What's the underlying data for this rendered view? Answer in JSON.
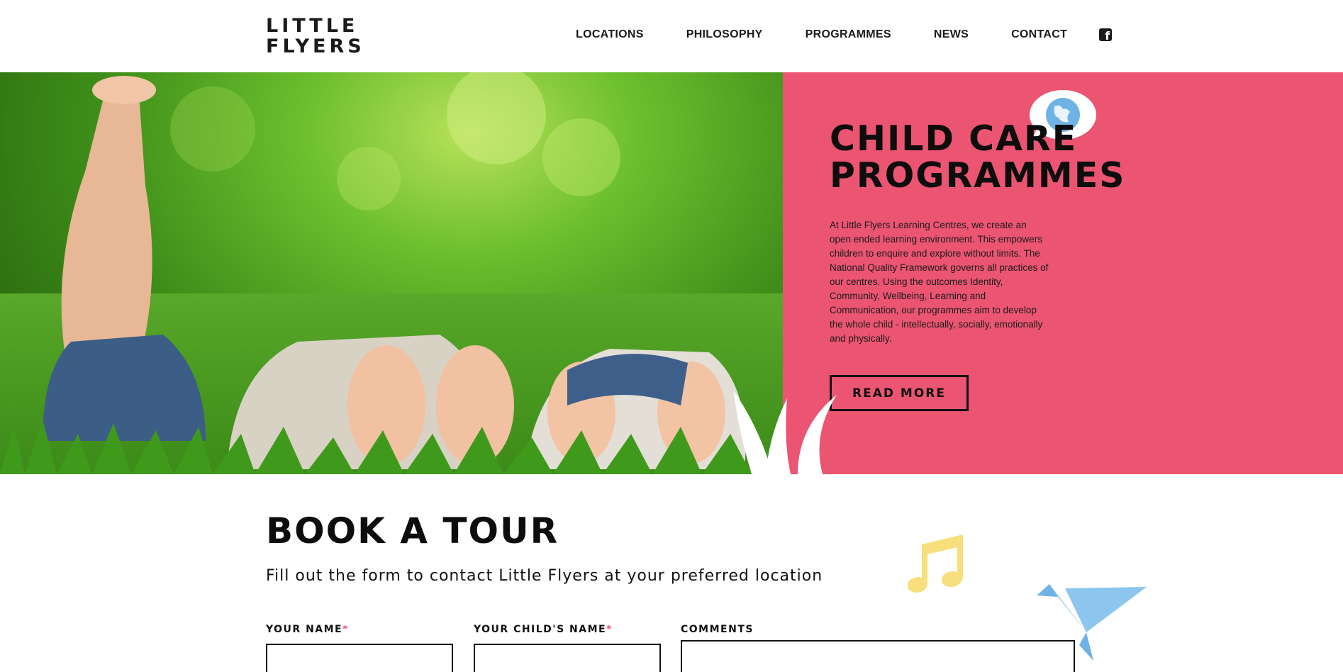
{
  "header": {
    "logo_line1": "LITTLE",
    "logo_line2": "FLYERS",
    "nav": [
      "LOCATIONS",
      "PHILOSOPHY",
      "PROGRAMMES",
      "NEWS",
      "CONTACT"
    ],
    "social_icon": "facebook-icon"
  },
  "hero": {
    "title_line1": "CHILD CARE",
    "title_line2": "PROGRAMMES",
    "body": "At Little Flyers Learning Centres, we create an open ended learning environment. This empowers children to enquire and explore without limits. The National Quality Framework governs all practices of our centres. Using the outcomes Identity, Community, Wellbeing, Learning and Communication, our programmes aim to develop the whole child - intellectually, socially, emotionally and physically.",
    "button": "READ MORE",
    "panel_color": "#eb5572",
    "bubble_icon": "globe-icon"
  },
  "tour": {
    "title": "BOOK A TOUR",
    "subtitle": "Fill out the form to contact Little Flyers at your preferred location",
    "fields": [
      {
        "label": "YOUR NAME",
        "required_mark": "*"
      },
      {
        "label": "YOUR CHILD'S NAME",
        "required_mark": "*"
      },
      {
        "label": "COMMENTS",
        "required_mark": ""
      }
    ],
    "decor_icons": [
      "music-note-icon",
      "paper-bird-icon"
    ]
  }
}
